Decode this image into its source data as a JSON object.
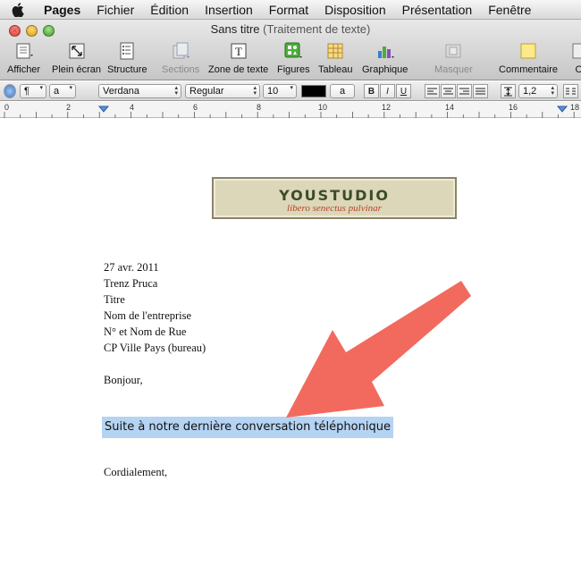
{
  "menubar": {
    "items": [
      "Pages",
      "Fichier",
      "Édition",
      "Insertion",
      "Format",
      "Disposition",
      "Présentation",
      "Fenêtre"
    ]
  },
  "window": {
    "title": "Sans titre",
    "subtitle": "(Traitement de texte)"
  },
  "toolbar": {
    "buttons": [
      {
        "label": "Afficher",
        "icon": "view-icon",
        "enabled": true
      },
      {
        "label": "Plein écran",
        "icon": "fullscreen-icon",
        "enabled": true
      },
      {
        "label": "Structure",
        "icon": "outline-icon",
        "enabled": true
      },
      {
        "label": "Sections",
        "icon": "sections-icon",
        "enabled": false
      },
      {
        "label": "Zone de texte",
        "icon": "textbox-icon",
        "enabled": true
      },
      {
        "label": "Figures",
        "icon": "shapes-icon",
        "enabled": true
      },
      {
        "label": "Tableau",
        "icon": "table-icon",
        "enabled": true
      },
      {
        "label": "Graphique",
        "icon": "chart-icon",
        "enabled": true
      },
      {
        "label": "Masquer",
        "icon": "mask-icon",
        "enabled": false
      },
      {
        "label": "Commentaire",
        "icon": "comment-icon",
        "enabled": true
      },
      {
        "label": "Ol",
        "icon": "more-icon",
        "enabled": true
      }
    ]
  },
  "formatbar": {
    "paragraph_style": "¶",
    "char_style": "a",
    "font": "Verdana",
    "typeface": "Regular",
    "size": "10",
    "text_color": "#000000",
    "highlight_label": "a",
    "bold": "B",
    "italic": "I",
    "underline": "U",
    "line_spacing": "1,2"
  },
  "ruler": {
    "labels": [
      "0",
      "2",
      "4",
      "6",
      "8",
      "10",
      "12",
      "14",
      "16",
      "18"
    ]
  },
  "document": {
    "logo": {
      "name": "YOUSTUDIO",
      "tagline": "libero senectus pulvinar"
    },
    "date": "27 avr. 2011",
    "address": [
      "Trenz Pruca",
      "Titre",
      "Nom de l'entreprise",
      "N° et Nom de Rue",
      "CP Ville Pays (bureau)"
    ],
    "greeting": "Bonjour,",
    "selected_text": "Suite à notre dernière conversation téléphonique",
    "closing": "Cordialement,"
  },
  "colors": {
    "selection": "#b5d3f2",
    "arrow": "#f26a5e",
    "logo_bg": "#dcd7b8"
  }
}
